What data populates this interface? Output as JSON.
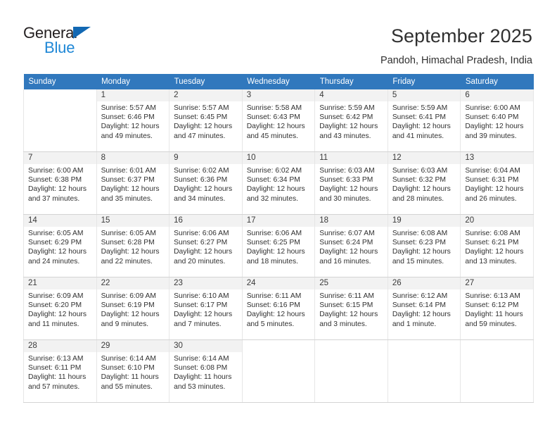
{
  "brand": {
    "logo_text_top": "General",
    "logo_text_bottom": "Blue",
    "logo_icon": "triangle-icon",
    "color_dark": "#231f20",
    "color_blue": "#1e87d6"
  },
  "header": {
    "title": "September 2025",
    "subtitle": "Pandoh, Himachal Pradesh, India"
  },
  "calendar": {
    "header_bg": "#3178bd",
    "daynum_bg": "#f2f2f2",
    "weekday_headers": [
      "Sunday",
      "Monday",
      "Tuesday",
      "Wednesday",
      "Thursday",
      "Friday",
      "Saturday"
    ],
    "labels": {
      "sunrise_prefix": "Sunrise:",
      "sunset_prefix": "Sunset:",
      "daylight_prefix": "Daylight:"
    },
    "weeks": [
      [
        {
          "day": "",
          "sunrise": "",
          "sunset": "",
          "daylight_line1": "",
          "daylight_line2": ""
        },
        {
          "day": "1",
          "sunrise": "Sunrise: 5:57 AM",
          "sunset": "Sunset: 6:46 PM",
          "daylight_line1": "Daylight: 12 hours",
          "daylight_line2": "and 49 minutes."
        },
        {
          "day": "2",
          "sunrise": "Sunrise: 5:57 AM",
          "sunset": "Sunset: 6:45 PM",
          "daylight_line1": "Daylight: 12 hours",
          "daylight_line2": "and 47 minutes."
        },
        {
          "day": "3",
          "sunrise": "Sunrise: 5:58 AM",
          "sunset": "Sunset: 6:43 PM",
          "daylight_line1": "Daylight: 12 hours",
          "daylight_line2": "and 45 minutes."
        },
        {
          "day": "4",
          "sunrise": "Sunrise: 5:59 AM",
          "sunset": "Sunset: 6:42 PM",
          "daylight_line1": "Daylight: 12 hours",
          "daylight_line2": "and 43 minutes."
        },
        {
          "day": "5",
          "sunrise": "Sunrise: 5:59 AM",
          "sunset": "Sunset: 6:41 PM",
          "daylight_line1": "Daylight: 12 hours",
          "daylight_line2": "and 41 minutes."
        },
        {
          "day": "6",
          "sunrise": "Sunrise: 6:00 AM",
          "sunset": "Sunset: 6:40 PM",
          "daylight_line1": "Daylight: 12 hours",
          "daylight_line2": "and 39 minutes."
        }
      ],
      [
        {
          "day": "7",
          "sunrise": "Sunrise: 6:00 AM",
          "sunset": "Sunset: 6:38 PM",
          "daylight_line1": "Daylight: 12 hours",
          "daylight_line2": "and 37 minutes."
        },
        {
          "day": "8",
          "sunrise": "Sunrise: 6:01 AM",
          "sunset": "Sunset: 6:37 PM",
          "daylight_line1": "Daylight: 12 hours",
          "daylight_line2": "and 35 minutes."
        },
        {
          "day": "9",
          "sunrise": "Sunrise: 6:02 AM",
          "sunset": "Sunset: 6:36 PM",
          "daylight_line1": "Daylight: 12 hours",
          "daylight_line2": "and 34 minutes."
        },
        {
          "day": "10",
          "sunrise": "Sunrise: 6:02 AM",
          "sunset": "Sunset: 6:34 PM",
          "daylight_line1": "Daylight: 12 hours",
          "daylight_line2": "and 32 minutes."
        },
        {
          "day": "11",
          "sunrise": "Sunrise: 6:03 AM",
          "sunset": "Sunset: 6:33 PM",
          "daylight_line1": "Daylight: 12 hours",
          "daylight_line2": "and 30 minutes."
        },
        {
          "day": "12",
          "sunrise": "Sunrise: 6:03 AM",
          "sunset": "Sunset: 6:32 PM",
          "daylight_line1": "Daylight: 12 hours",
          "daylight_line2": "and 28 minutes."
        },
        {
          "day": "13",
          "sunrise": "Sunrise: 6:04 AM",
          "sunset": "Sunset: 6:31 PM",
          "daylight_line1": "Daylight: 12 hours",
          "daylight_line2": "and 26 minutes."
        }
      ],
      [
        {
          "day": "14",
          "sunrise": "Sunrise: 6:05 AM",
          "sunset": "Sunset: 6:29 PM",
          "daylight_line1": "Daylight: 12 hours",
          "daylight_line2": "and 24 minutes."
        },
        {
          "day": "15",
          "sunrise": "Sunrise: 6:05 AM",
          "sunset": "Sunset: 6:28 PM",
          "daylight_line1": "Daylight: 12 hours",
          "daylight_line2": "and 22 minutes."
        },
        {
          "day": "16",
          "sunrise": "Sunrise: 6:06 AM",
          "sunset": "Sunset: 6:27 PM",
          "daylight_line1": "Daylight: 12 hours",
          "daylight_line2": "and 20 minutes."
        },
        {
          "day": "17",
          "sunrise": "Sunrise: 6:06 AM",
          "sunset": "Sunset: 6:25 PM",
          "daylight_line1": "Daylight: 12 hours",
          "daylight_line2": "and 18 minutes."
        },
        {
          "day": "18",
          "sunrise": "Sunrise: 6:07 AM",
          "sunset": "Sunset: 6:24 PM",
          "daylight_line1": "Daylight: 12 hours",
          "daylight_line2": "and 16 minutes."
        },
        {
          "day": "19",
          "sunrise": "Sunrise: 6:08 AM",
          "sunset": "Sunset: 6:23 PM",
          "daylight_line1": "Daylight: 12 hours",
          "daylight_line2": "and 15 minutes."
        },
        {
          "day": "20",
          "sunrise": "Sunrise: 6:08 AM",
          "sunset": "Sunset: 6:21 PM",
          "daylight_line1": "Daylight: 12 hours",
          "daylight_line2": "and 13 minutes."
        }
      ],
      [
        {
          "day": "21",
          "sunrise": "Sunrise: 6:09 AM",
          "sunset": "Sunset: 6:20 PM",
          "daylight_line1": "Daylight: 12 hours",
          "daylight_line2": "and 11 minutes."
        },
        {
          "day": "22",
          "sunrise": "Sunrise: 6:09 AM",
          "sunset": "Sunset: 6:19 PM",
          "daylight_line1": "Daylight: 12 hours",
          "daylight_line2": "and 9 minutes."
        },
        {
          "day": "23",
          "sunrise": "Sunrise: 6:10 AM",
          "sunset": "Sunset: 6:17 PM",
          "daylight_line1": "Daylight: 12 hours",
          "daylight_line2": "and 7 minutes."
        },
        {
          "day": "24",
          "sunrise": "Sunrise: 6:11 AM",
          "sunset": "Sunset: 6:16 PM",
          "daylight_line1": "Daylight: 12 hours",
          "daylight_line2": "and 5 minutes."
        },
        {
          "day": "25",
          "sunrise": "Sunrise: 6:11 AM",
          "sunset": "Sunset: 6:15 PM",
          "daylight_line1": "Daylight: 12 hours",
          "daylight_line2": "and 3 minutes."
        },
        {
          "day": "26",
          "sunrise": "Sunrise: 6:12 AM",
          "sunset": "Sunset: 6:14 PM",
          "daylight_line1": "Daylight: 12 hours",
          "daylight_line2": "and 1 minute."
        },
        {
          "day": "27",
          "sunrise": "Sunrise: 6:13 AM",
          "sunset": "Sunset: 6:12 PM",
          "daylight_line1": "Daylight: 11 hours",
          "daylight_line2": "and 59 minutes."
        }
      ],
      [
        {
          "day": "28",
          "sunrise": "Sunrise: 6:13 AM",
          "sunset": "Sunset: 6:11 PM",
          "daylight_line1": "Daylight: 11 hours",
          "daylight_line2": "and 57 minutes."
        },
        {
          "day": "29",
          "sunrise": "Sunrise: 6:14 AM",
          "sunset": "Sunset: 6:10 PM",
          "daylight_line1": "Daylight: 11 hours",
          "daylight_line2": "and 55 minutes."
        },
        {
          "day": "30",
          "sunrise": "Sunrise: 6:14 AM",
          "sunset": "Sunset: 6:08 PM",
          "daylight_line1": "Daylight: 11 hours",
          "daylight_line2": "and 53 minutes."
        },
        {
          "day": "",
          "sunrise": "",
          "sunset": "",
          "daylight_line1": "",
          "daylight_line2": ""
        },
        {
          "day": "",
          "sunrise": "",
          "sunset": "",
          "daylight_line1": "",
          "daylight_line2": ""
        },
        {
          "day": "",
          "sunrise": "",
          "sunset": "",
          "daylight_line1": "",
          "daylight_line2": ""
        },
        {
          "day": "",
          "sunrise": "",
          "sunset": "",
          "daylight_line1": "",
          "daylight_line2": ""
        }
      ]
    ]
  }
}
